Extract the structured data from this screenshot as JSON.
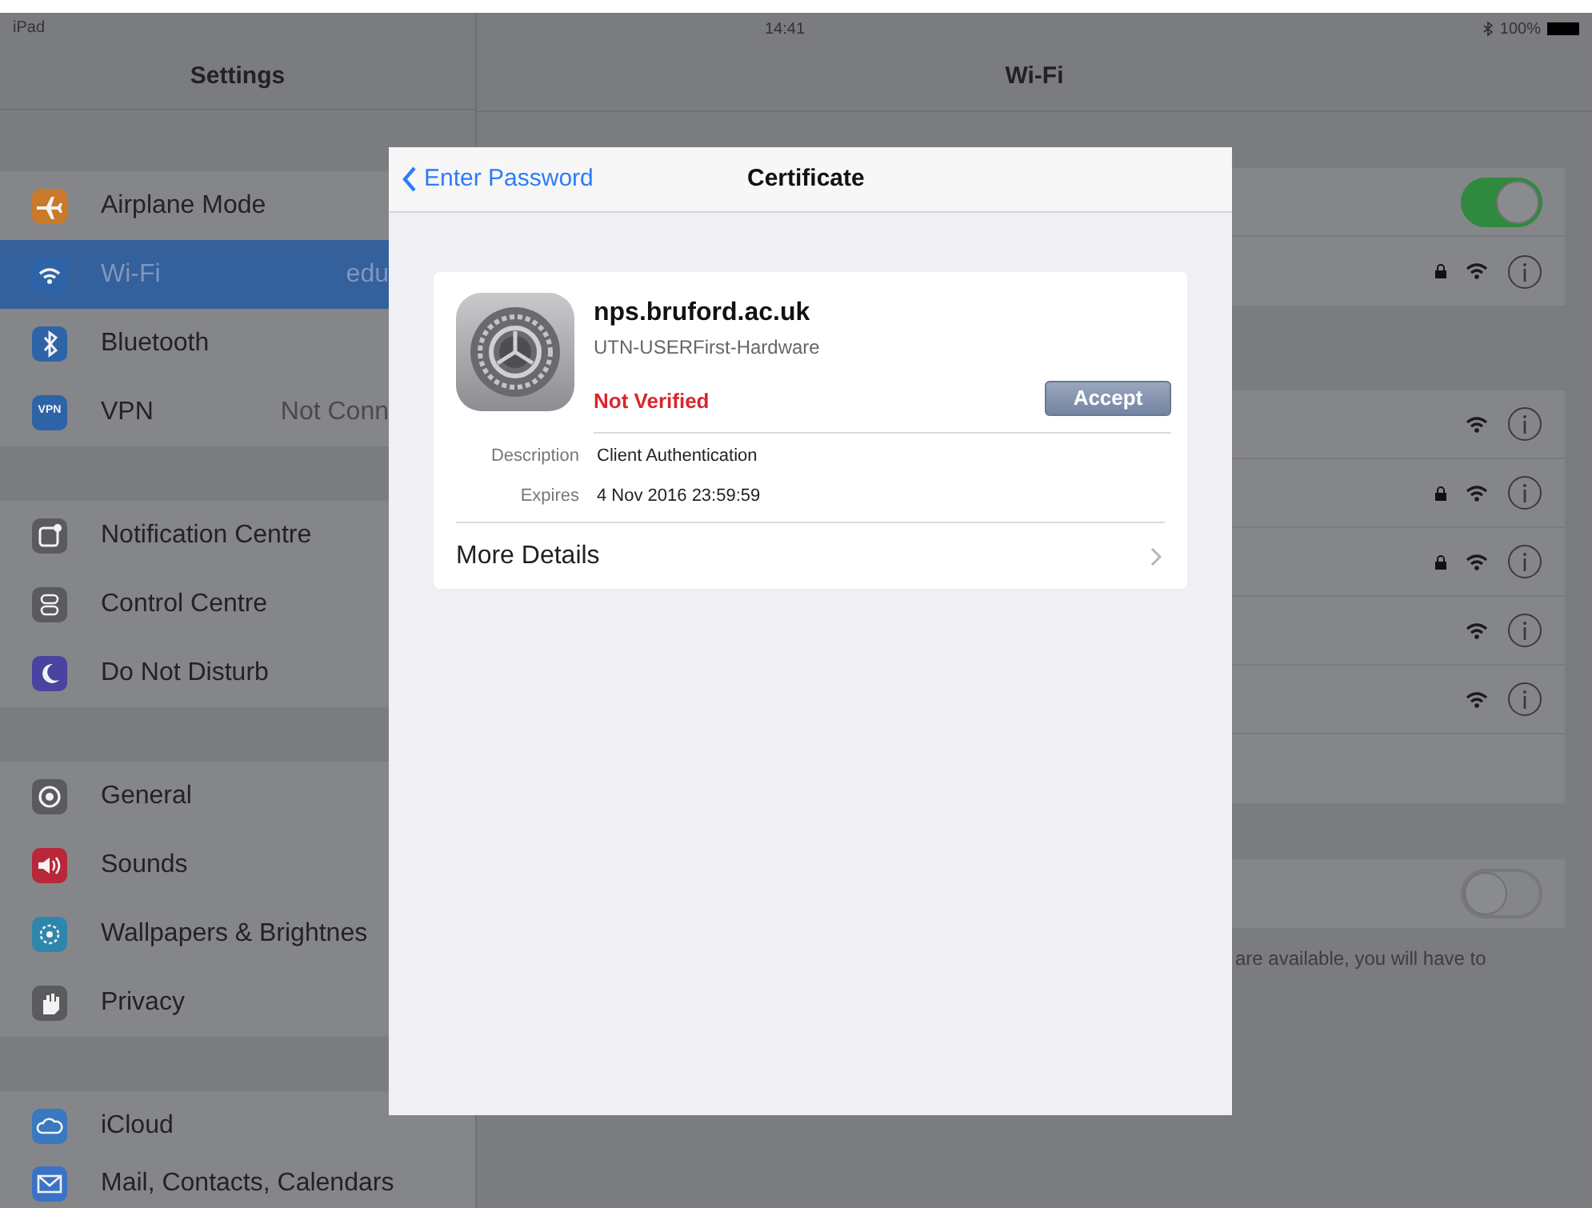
{
  "status_bar": {
    "device": "iPad",
    "time": "14:41",
    "battery": "100%"
  },
  "sidebar": {
    "title": "Settings",
    "groups": [
      [
        {
          "label": "Airplane Mode",
          "color": "#c97a2a",
          "selected": false
        },
        {
          "label": "Wi-Fi",
          "value": "edu",
          "color": "#2d64a8",
          "selected": true
        },
        {
          "label": "Bluetooth",
          "color": "#2d64a8",
          "selected": false
        },
        {
          "label": "VPN",
          "value": "Not Conn",
          "icon_text": "VPN",
          "color": "#2d64a8",
          "selected": false
        }
      ],
      [
        {
          "label": "Notification Centre",
          "color": "#5a5b5e",
          "selected": false
        },
        {
          "label": "Control Centre",
          "color": "#5a5b5e",
          "selected": false
        },
        {
          "label": "Do Not Disturb",
          "color": "#4a43a0",
          "selected": false
        }
      ],
      [
        {
          "label": "General",
          "color": "#5a5b5e",
          "selected": false
        },
        {
          "label": "Sounds",
          "color": "#b8283a",
          "selected": false
        },
        {
          "label": "Wallpapers & Brightnes",
          "color": "#2e86ad",
          "selected": false
        },
        {
          "label": "Privacy",
          "color": "#5a5b5e",
          "selected": false
        }
      ],
      [
        {
          "label": "iCloud",
          "color": "#3a78c0",
          "selected": false
        },
        {
          "label": "Mail, Contacts, Calendars",
          "color": "#3a72c8",
          "selected": false
        }
      ]
    ]
  },
  "wifi": {
    "title": "Wi-Fi",
    "groups": [
      [
        {
          "kind": "toggle",
          "on": true
        },
        {
          "kind": "network",
          "locked": true
        }
      ],
      [
        {
          "kind": "network",
          "locked": false
        },
        {
          "kind": "network",
          "locked": true
        },
        {
          "kind": "network",
          "locked": true
        },
        {
          "kind": "network",
          "locked": false
        },
        {
          "kind": "network",
          "locked": false
        },
        {
          "kind": "blank"
        }
      ],
      [
        {
          "kind": "toggle",
          "on": false
        }
      ]
    ],
    "footer": "are available, you will have to"
  },
  "modal": {
    "back": "Enter Password",
    "title": "Certificate",
    "cert": {
      "name": "nps.bruford.ac.uk",
      "issuer": "UTN-USERFirst-Hardware",
      "status": "Not Verified",
      "verified": false,
      "action": "Accept"
    },
    "details": [
      {
        "label": "Description",
        "value": "Client Authentication"
      },
      {
        "label": "Expires",
        "value": "4 Nov 2016 23:59:59"
      }
    ],
    "more": "More Details"
  }
}
